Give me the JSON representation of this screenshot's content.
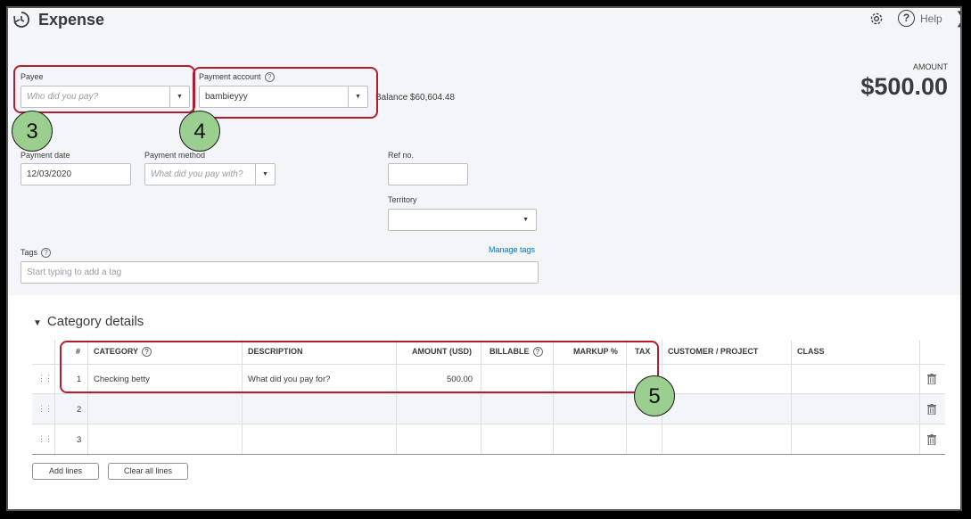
{
  "header": {
    "title": "Expense",
    "help_label": "Help"
  },
  "payee": {
    "label": "Payee",
    "placeholder": "Who did you pay?"
  },
  "payment_account": {
    "label": "Payment account",
    "value": "bambieyyy",
    "balance": "Balance $60,604.48"
  },
  "amount": {
    "label": "AMOUNT",
    "value": "$500.00"
  },
  "payment_date": {
    "label": "Payment date",
    "value": "12/03/2020"
  },
  "payment_method": {
    "label": "Payment method",
    "placeholder": "What did you pay with?"
  },
  "ref_no": {
    "label": "Ref no."
  },
  "territory": {
    "label": "Territory"
  },
  "tags": {
    "label": "Tags",
    "manage_link": "Manage tags",
    "placeholder": "Start typing to add a tag"
  },
  "category_details": {
    "title": "Category details",
    "columns": [
      "#",
      "CATEGORY",
      "DESCRIPTION",
      "AMOUNT (USD)",
      "BILLABLE",
      "MARKUP %",
      "TAX",
      "CUSTOMER / PROJECT",
      "CLASS"
    ],
    "rows": [
      {
        "num": "1",
        "category": "Checking betty",
        "description_placeholder": "What did you pay for?",
        "amount": "500.00"
      },
      {
        "num": "2"
      },
      {
        "num": "3"
      }
    ],
    "add_lines": "Add lines",
    "clear_all": "Clear all lines"
  },
  "annotations": {
    "badge3": "3",
    "badge4": "4",
    "badge5": "5"
  },
  "colors": {
    "callout": "#b01e2f",
    "badge": "#9bcf8f",
    "link": "#0077c5"
  }
}
